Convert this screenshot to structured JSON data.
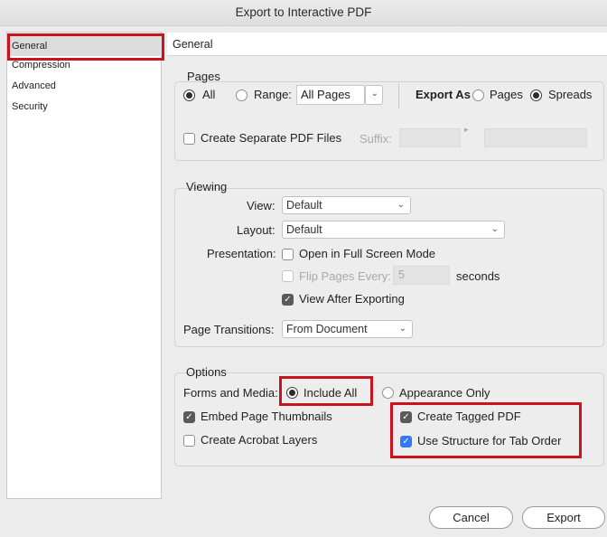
{
  "window": {
    "title": "Export to Interactive PDF"
  },
  "sidebar": {
    "items": [
      {
        "label": "General"
      },
      {
        "label": "Compression"
      },
      {
        "label": "Advanced"
      },
      {
        "label": "Security"
      }
    ]
  },
  "main": {
    "header": "General"
  },
  "pages": {
    "title": "Pages",
    "all_label": "All",
    "range_label": "Range:",
    "range_value": "All Pages",
    "export_as_label": "Export As",
    "pages_option": "Pages",
    "spreads_option": "Spreads",
    "separate_files_label": "Create Separate PDF Files",
    "suffix_label": "Suffix:"
  },
  "viewing": {
    "title": "Viewing",
    "view_label": "View:",
    "view_value": "Default",
    "layout_label": "Layout:",
    "layout_value": "Default",
    "presentation_label": "Presentation:",
    "full_screen_label": "Open in Full Screen Mode",
    "flip_pages_label": "Flip Pages Every:",
    "flip_value": "5",
    "seconds_label": "seconds",
    "view_after_label": "View After Exporting",
    "transitions_label": "Page Transitions:",
    "transitions_value": "From Document"
  },
  "options": {
    "title": "Options",
    "forms_label": "Forms and Media:",
    "include_all_label": "Include All",
    "appearance_only_label": "Appearance Only",
    "embed_thumbnails_label": "Embed Page Thumbnails",
    "acrobat_layers_label": "Create Acrobat Layers",
    "tagged_pdf_label": "Create Tagged PDF",
    "structure_tab_label": "Use Structure for Tab Order"
  },
  "buttons": {
    "cancel": "Cancel",
    "export": "Export"
  },
  "colors": {
    "highlight": "#c7141e",
    "checkbox_blue": "#2f7bf6"
  },
  "icons": {
    "checkmark": "✓",
    "chevron": "⌄",
    "arrow": "▸"
  }
}
